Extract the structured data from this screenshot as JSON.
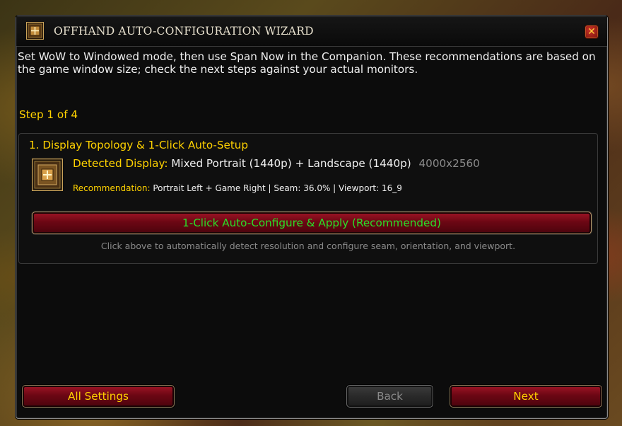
{
  "window": {
    "title": "OFFHAND AUTO-CONFIGURATION WIZARD",
    "close_icon": "close-icon",
    "close_label": "✕"
  },
  "intro": {
    "text": "Set WoW to Windowed mode, then use Span Now in the Companion. These recommendations are based on the game window size; check the next steps against your actual monitors."
  },
  "step": {
    "label": "Step 1 of 4"
  },
  "panel": {
    "title": "1. Display Topology & 1-Click Auto-Setup",
    "detected_label": "Detected Display:",
    "detected_value": "Mixed Portrait (1440p) + Landscape (1440p)",
    "resolution": "4000x2560",
    "recommendation_label": "Recommendation:",
    "recommendation_value": "Portrait Left + Game Right | Seam: 36.0% | Viewport: 16_9",
    "auto_button_label": "1-Click Auto-Configure & Apply (Recommended)",
    "hint": "Click above to automatically detect resolution and configure seam, orientation, and viewport."
  },
  "footer": {
    "all_settings_label": "All Settings",
    "back_label": "Back",
    "next_label": "Next"
  },
  "colors": {
    "accent_gold": "#ffd200",
    "button_green_text": "#29e029",
    "button_red": "#6c0714",
    "muted_gray": "#8a8a8a",
    "frame_bg": "#0c0c0c"
  }
}
